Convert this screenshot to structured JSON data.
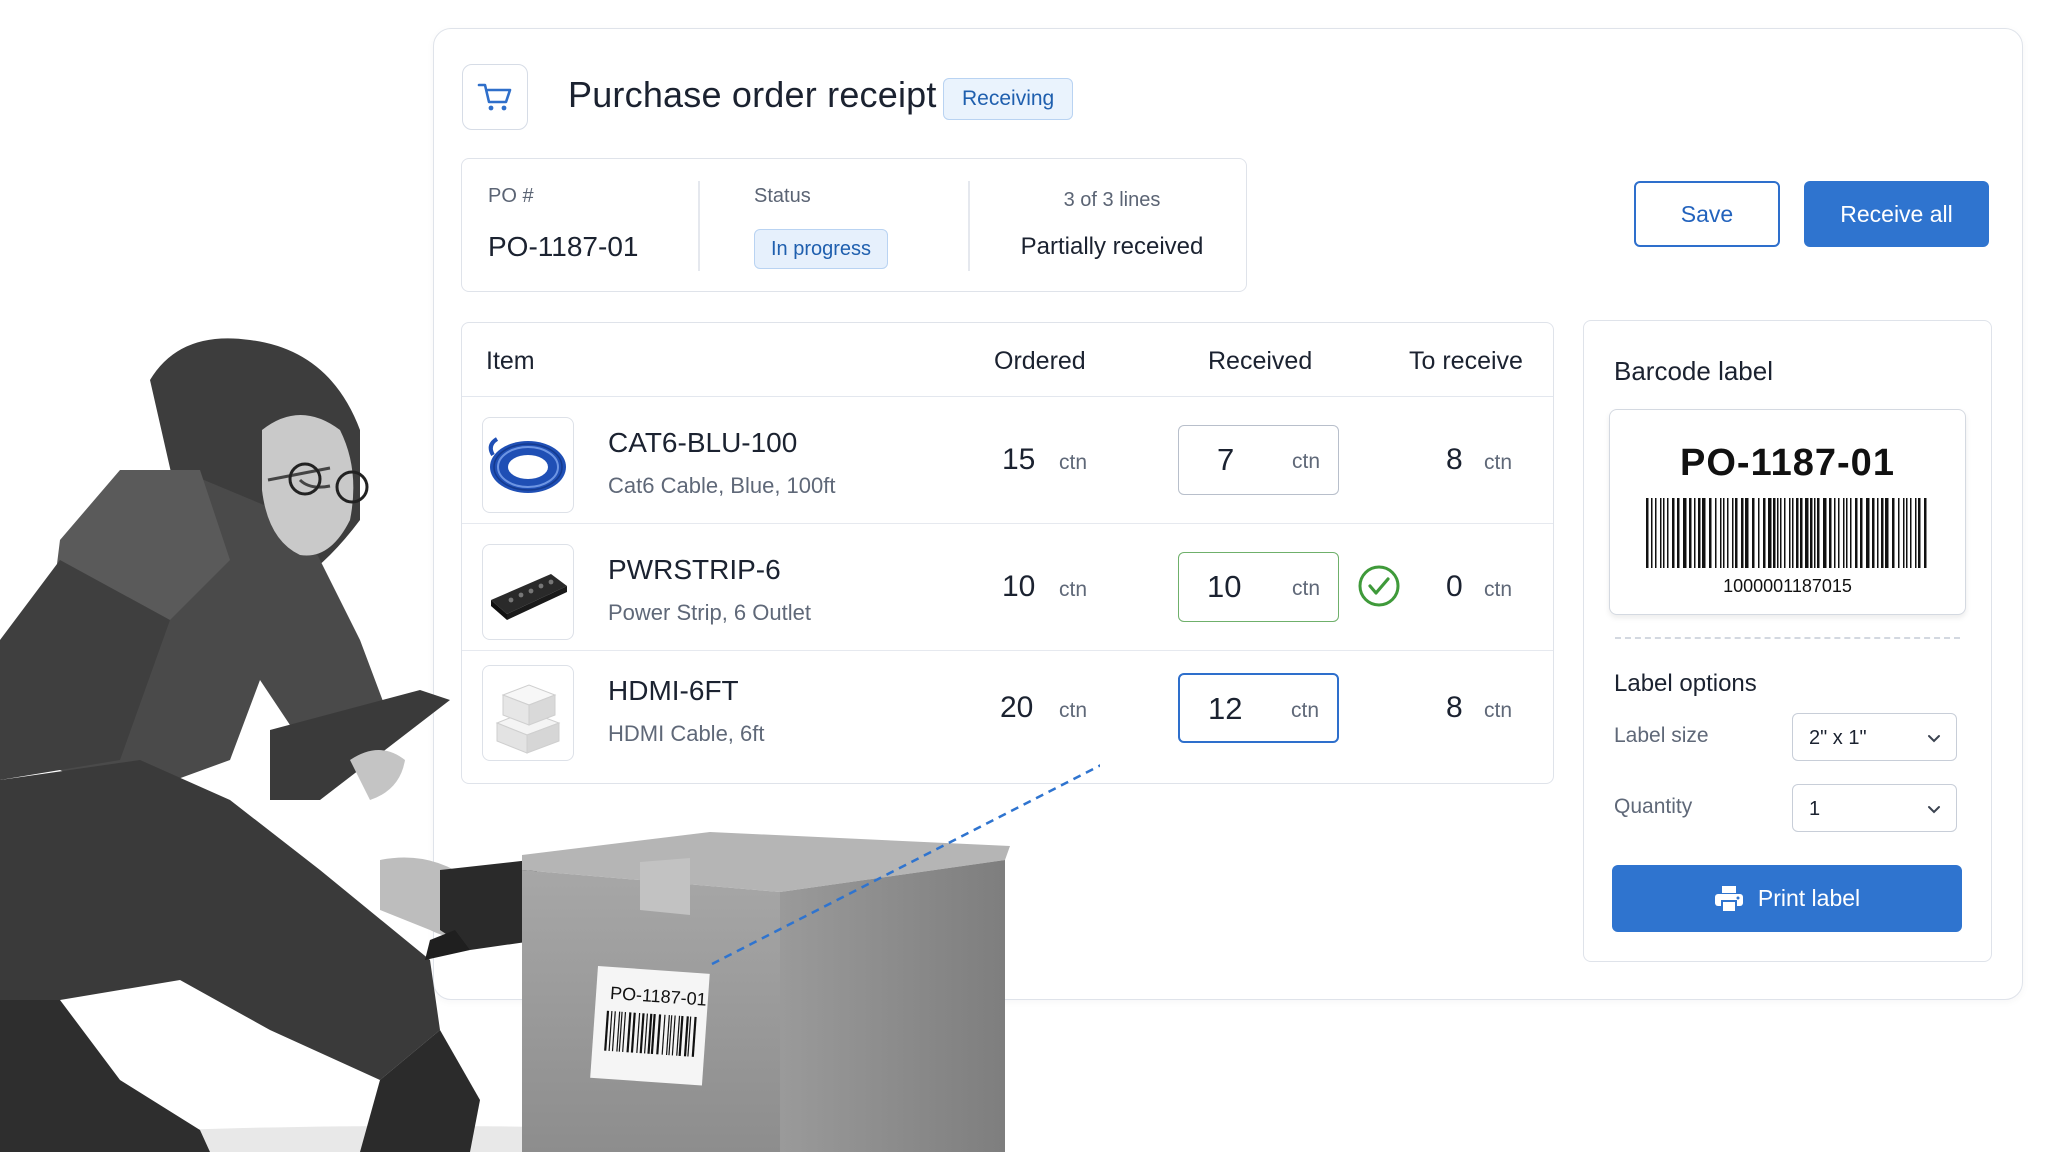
{
  "header": {
    "title": "Purchase order receipt",
    "badge": "Receiving"
  },
  "summary": {
    "po_label": "PO #",
    "po_value": "PO-1187-01",
    "status_label": "Status",
    "status_value": "In progress",
    "lines_label": "3 of 3 lines",
    "lines_value": "Partially received"
  },
  "actions": {
    "save": "Save",
    "receive_all": "Receive all"
  },
  "table": {
    "headers": [
      "Item",
      "Ordered",
      "Received",
      "To receive"
    ],
    "rows": [
      {
        "sku": "CAT6-BLU-100",
        "desc": "Cat6 Cable, Blue, 100ft",
        "ordered": "15",
        "received": "7",
        "to_receive": "8",
        "unit": "ctn",
        "thumb": "cable-coil-image"
      },
      {
        "sku": "PWRSTRIP-6",
        "desc": "Power Strip, 6 Outlet",
        "ordered": "10",
        "received": "10",
        "to_receive": "0",
        "unit": "ctn",
        "thumb": "power-strip-image"
      },
      {
        "sku": "HDMI-6FT",
        "desc": "HDMI Cable, 6ft",
        "ordered": "20",
        "received": "12",
        "to_receive": "8",
        "unit": "ctn",
        "thumb": "boxes-image"
      }
    ]
  },
  "barcode_panel": {
    "title": "Barcode label",
    "label_code": "PO-1187-01",
    "barcode_number": "1000001187015",
    "options_title": "Label options",
    "size_label": "Label size",
    "size_value": "2\" x 1\"",
    "quantity_label": "Quantity",
    "quantity_value": "1",
    "print": "Print label"
  },
  "photo": {
    "box_label": "PO-1187-01"
  },
  "colors": {
    "accent": "#2f74cf",
    "success": "#3f9a3a",
    "badge_bg": "#eaf3fd"
  }
}
